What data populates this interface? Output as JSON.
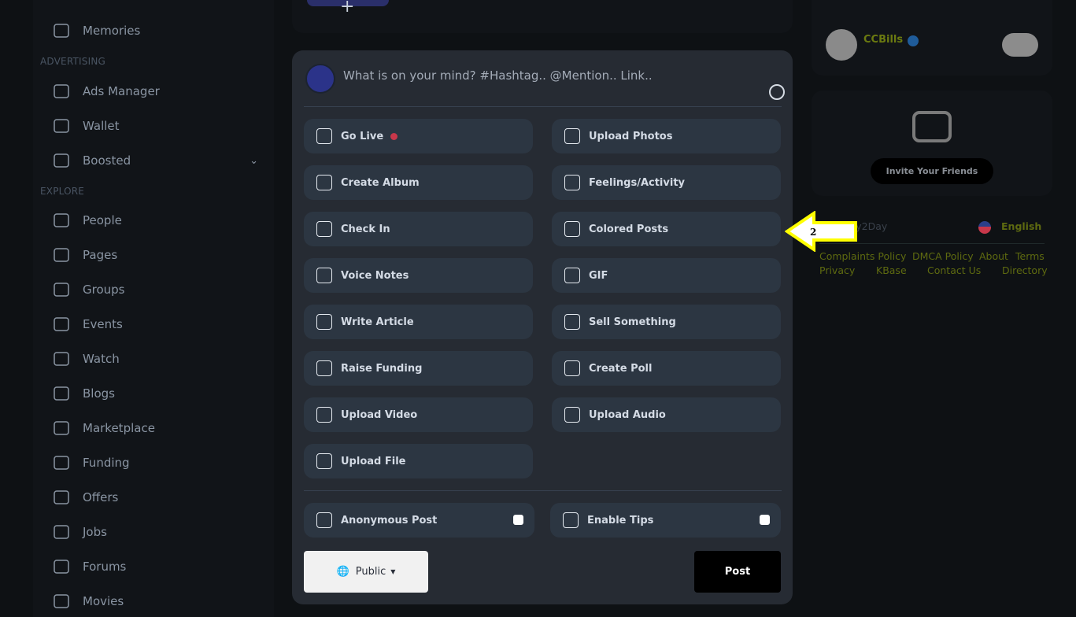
{
  "sidebar": {
    "sections": {
      "advertising": "ADVERTISING",
      "explore": "EXPLORE"
    },
    "items": [
      {
        "label": "Memories",
        "icon": "memories-icon"
      },
      {
        "label": "Ads Manager",
        "icon": "megaphone-icon"
      },
      {
        "label": "Wallet",
        "icon": "wallet-icon"
      },
      {
        "label": "Boosted",
        "icon": "rocket-icon"
      },
      {
        "label": "People",
        "icon": "people-icon"
      },
      {
        "label": "Pages",
        "icon": "flag-icon"
      },
      {
        "label": "Groups",
        "icon": "groups-icon"
      },
      {
        "label": "Events",
        "icon": "calendar-icon"
      },
      {
        "label": "Watch",
        "icon": "watch-icon"
      },
      {
        "label": "Blogs",
        "icon": "blog-icon"
      },
      {
        "label": "Marketplace",
        "icon": "store-icon"
      },
      {
        "label": "Funding",
        "icon": "money-bag-icon"
      },
      {
        "label": "Offers",
        "icon": "offer-icon"
      },
      {
        "label": "Jobs",
        "icon": "briefcase-icon"
      },
      {
        "label": "Forums",
        "icon": "forum-icon"
      },
      {
        "label": "Movies",
        "icon": "movie-icon"
      }
    ]
  },
  "composer": {
    "placeholder": "What is on your mind? #Hashtag.. @Mention.. Link..",
    "actions": [
      "Go Live",
      "Upload Photos",
      "Create Album",
      "Feelings/Activity",
      "Check In",
      "Colored Posts",
      "Voice Notes",
      "GIF",
      "Write Article",
      "Sell Something",
      "Raise Funding",
      "Create Poll",
      "Upload Video",
      "Upload Audio",
      "Upload File"
    ],
    "anonymous": "Anonymous Post",
    "tips": "Enable Tips",
    "privacy": "Public",
    "post": "Post",
    "live_color": "#c8374a"
  },
  "right": {
    "user": "CCBills",
    "invite": "Invite Your Friends",
    "brand": "Day2Day",
    "language": "English",
    "links": [
      "Complaints Policy",
      "DMCA Policy",
      "About",
      "Terms",
      "Privacy",
      "KBase",
      "Contact Us",
      "Directory"
    ],
    "accent": "#6b7a10"
  },
  "annotation": {
    "label": "2",
    "color": "#ffff00"
  }
}
